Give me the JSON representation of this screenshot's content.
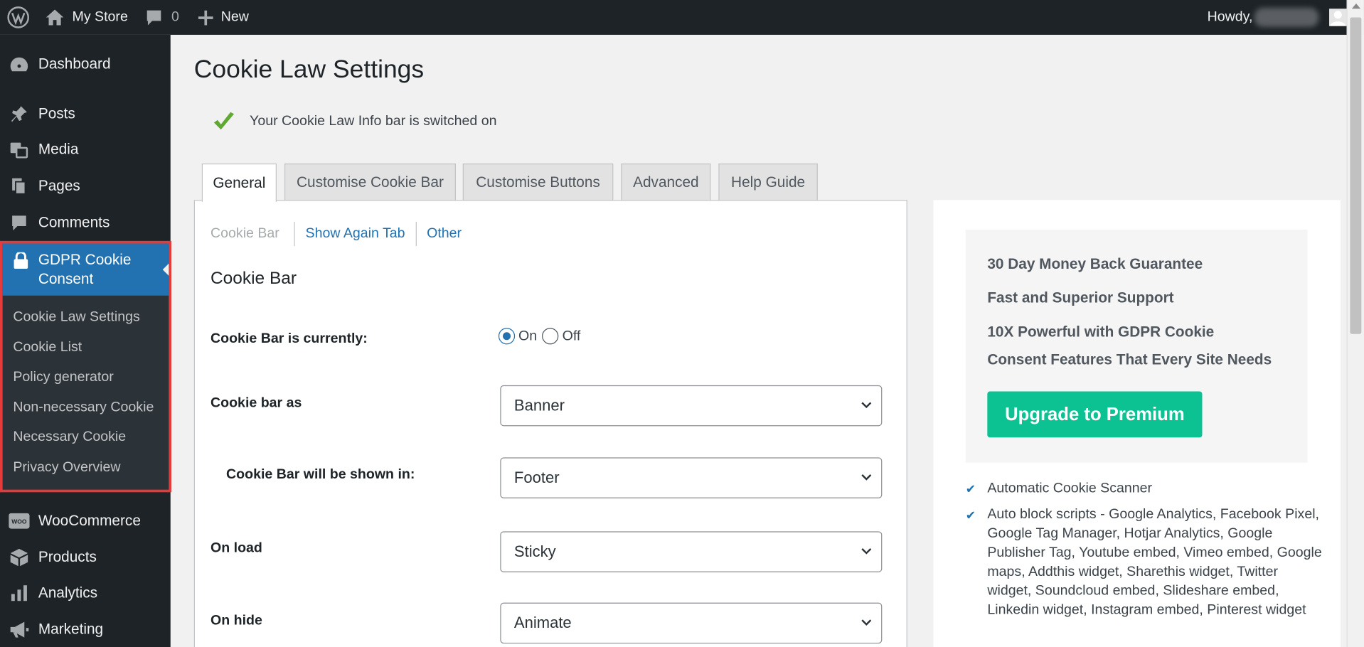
{
  "adminbar": {
    "site_name": "My Store",
    "comments_count": "0",
    "new_label": "New",
    "howdy": "Howdy,"
  },
  "sidebar": {
    "items": [
      {
        "label": "Dashboard",
        "icon": "dashboard-icon"
      },
      {
        "label": "Posts",
        "icon": "pin-icon"
      },
      {
        "label": "Media",
        "icon": "media-icon"
      },
      {
        "label": "Pages",
        "icon": "pages-icon"
      },
      {
        "label": "Comments",
        "icon": "comment-icon"
      },
      {
        "label": "GDPR Cookie Consent",
        "icon": "lock-icon"
      },
      {
        "label": "WooCommerce",
        "icon": "woo-icon"
      },
      {
        "label": "Products",
        "icon": "box-icon"
      },
      {
        "label": "Analytics",
        "icon": "bars-icon"
      },
      {
        "label": "Marketing",
        "icon": "megaphone-icon"
      }
    ],
    "active_line1": "GDPR Cookie",
    "active_line2": "Consent",
    "submenu": [
      "Cookie Law Settings",
      "Cookie List",
      "Policy generator",
      "Non-necessary Cookie",
      "Necessary Cookie",
      "Privacy Overview"
    ]
  },
  "main": {
    "title": "Cookie Law Settings",
    "notice": "Your Cookie Law Info bar is switched on",
    "tabs": [
      "General",
      "Customise Cookie Bar",
      "Customise Buttons",
      "Advanced",
      "Help Guide"
    ],
    "subtabs": [
      "Cookie Bar",
      "Show Again Tab",
      "Other"
    ],
    "section_title": "Cookie Bar",
    "fields": {
      "status_label": "Cookie Bar is currently:",
      "radio_on": "On",
      "radio_off": "Off",
      "bar_as_label": "Cookie bar as",
      "bar_as_value": "Banner",
      "shown_in_label": "Cookie Bar will be shown in:",
      "shown_in_value": "Footer",
      "on_load_label": "On load",
      "on_load_value": "Sticky",
      "on_hide_label": "On hide",
      "on_hide_value": "Animate"
    }
  },
  "promo": {
    "line1": "30 Day Money Back Guarantee",
    "line2": "Fast and Superior Support",
    "line3a": "10X Powerful with GDPR Cookie",
    "line3b": "Consent Features That Every Site Needs",
    "button": "Upgrade to Premium",
    "features": [
      "Automatic Cookie Scanner",
      "Auto block scripts - Google Analytics, Facebook Pixel, Google Tag Manager, Hotjar Analytics, Google Publisher Tag, Youtube embed, Vimeo embed, Google maps, Addthis widget, Sharethis widget, Twitter widget, Soundcloud embed, Slideshare embed, Linkedin widget, Instagram embed, Pinterest widget"
    ]
  },
  "colors": {
    "admin_dark": "#1d2327",
    "accent_blue": "#2271b1",
    "upgrade_green": "#0cc293",
    "highlight_red": "#e33b3b",
    "check_green": "#5fa831"
  }
}
